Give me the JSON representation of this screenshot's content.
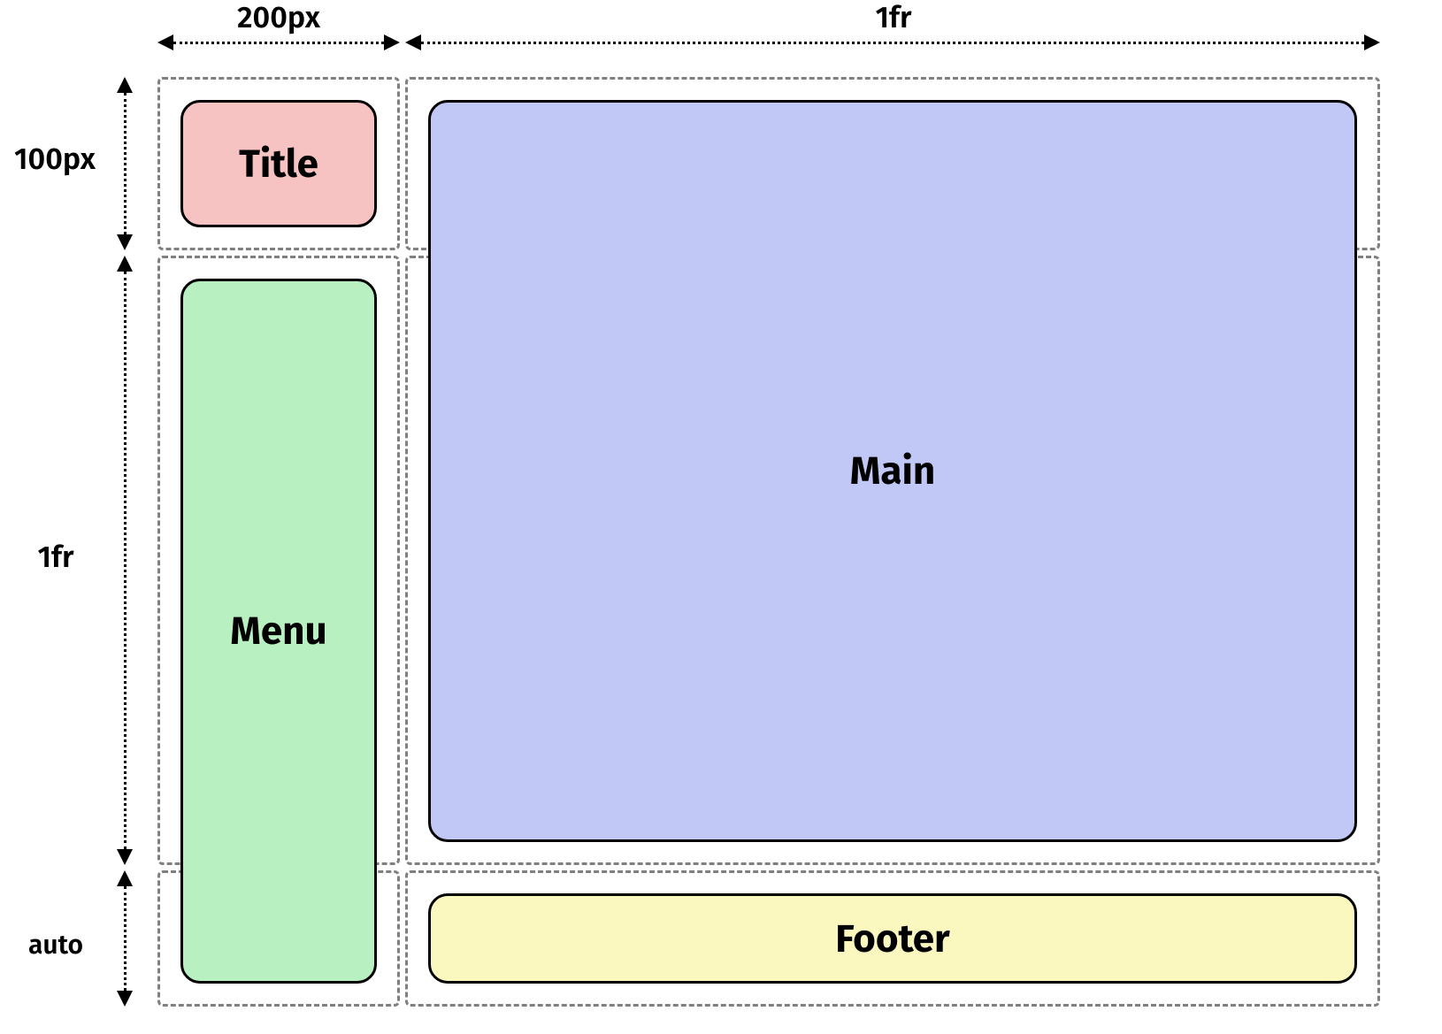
{
  "diagram": {
    "columns": {
      "col1": {
        "label": "200px"
      },
      "col2": {
        "label": "1fr"
      }
    },
    "rows": {
      "row1": {
        "label": "100px"
      },
      "row2": {
        "label": "1fr"
      },
      "row3": {
        "label": "auto"
      }
    },
    "regions": {
      "title": {
        "label": "Title",
        "color": "#f6c2c2"
      },
      "menu": {
        "label": "Menu",
        "color": "#b8f0c2"
      },
      "main": {
        "label": "Main",
        "color": "#c2c8f5"
      },
      "footer": {
        "label": "Footer",
        "color": "#fbf8bf"
      }
    }
  }
}
